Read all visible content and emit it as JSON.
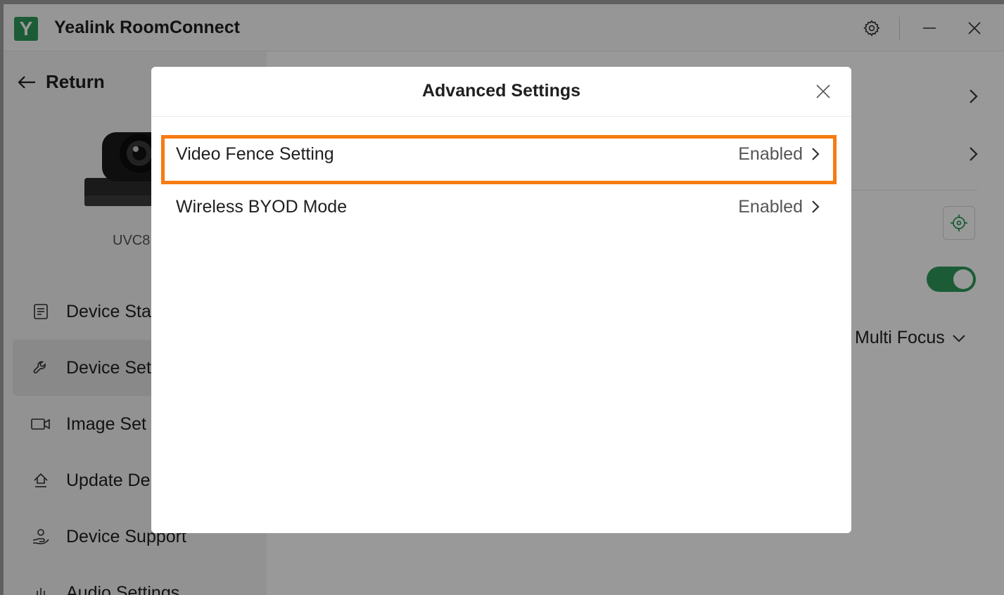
{
  "app": {
    "title": "Yealink RoomConnect",
    "logo_letter": "Y"
  },
  "sidebar": {
    "return_label": "Return",
    "device_model": "UVC8",
    "items": [
      {
        "label": "Device Sta",
        "icon": "document-icon"
      },
      {
        "label": "Device Set",
        "icon": "wrench-icon",
        "active": true
      },
      {
        "label": "Image Set",
        "icon": "video-camera-icon"
      },
      {
        "label": "Update De",
        "icon": "upload-icon"
      },
      {
        "label": "Device Support",
        "icon": "support-icon"
      },
      {
        "label": "Audio Settings",
        "icon": "audio-bars-icon"
      }
    ]
  },
  "main": {
    "focus_mode": "Multi Focus",
    "toggle_on": true
  },
  "modal": {
    "title": "Advanced Settings",
    "rows": [
      {
        "label": "Video Fence Setting",
        "value": "Enabled",
        "highlighted": true
      },
      {
        "label": "Wireless BYOD Mode",
        "value": "Enabled"
      }
    ]
  },
  "colors": {
    "brand_green": "#2e9a5a",
    "highlight_orange": "#f57c12"
  }
}
